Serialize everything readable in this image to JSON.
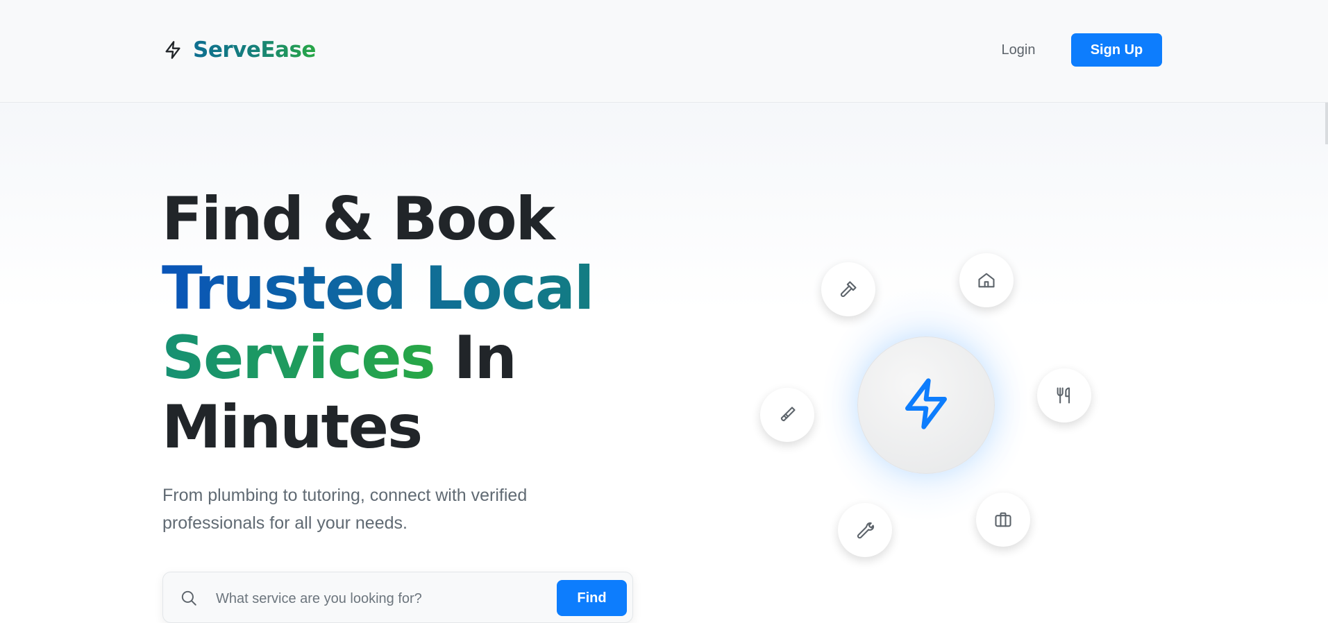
{
  "header": {
    "brand": "ServeEase",
    "login_label": "Login",
    "signup_label": "Sign Up"
  },
  "hero": {
    "headline_line1": "Find & Book",
    "headline_trusted": "Trusted Local",
    "headline_services": "Services",
    "headline_in": "In",
    "headline_line4": "Minutes",
    "subtext": "From plumbing to tutoring, connect with verified professionals for all your needs."
  },
  "search": {
    "placeholder": "What service are you looking for?",
    "value": "",
    "button_label": "Find"
  },
  "illustration": {
    "center_icon": "lightning-bolt-icon",
    "orbit_icons": [
      "hammer-icon",
      "home-icon",
      "utensils-icon",
      "paintbrush-icon",
      "wrench-icon",
      "briefcase-icon"
    ]
  },
  "colors": {
    "primary": "#0d7dfd",
    "heading": "#212529",
    "muted": "#606a73",
    "gradient_blue": "#0a55b8",
    "gradient_teal": "#137d82",
    "gradient_green": "#28a745"
  }
}
